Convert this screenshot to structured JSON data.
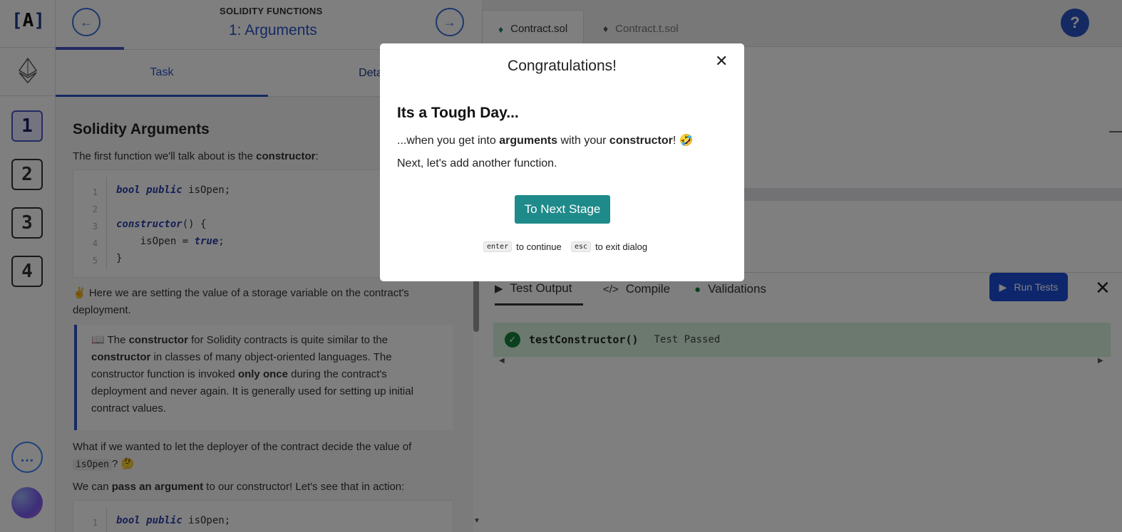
{
  "rail": {
    "logo_left": "[",
    "logo_mid": "A",
    "logo_right": "]",
    "stages": [
      "1",
      "2",
      "3",
      "4"
    ],
    "active_stage": 1,
    "more_icon": "…"
  },
  "header": {
    "course": "SOLIDITY FUNCTIONS",
    "title": "1: Arguments",
    "prev_icon": "←",
    "next_icon": "→"
  },
  "tabs": {
    "task": "Task",
    "details": "Deta"
  },
  "content": {
    "heading": "Solidity Arguments",
    "p1_pre": "The first function we'll talk about is the ",
    "p1_bold": "constructor",
    "p1_post": ":",
    "code1": [
      {
        "n": "1",
        "line": "bool public isOpen;"
      },
      {
        "n": "2",
        "line": ""
      },
      {
        "n": "3",
        "line": "constructor() {"
      },
      {
        "n": "4",
        "line": "    isOpen = true;"
      },
      {
        "n": "5",
        "line": "}"
      }
    ],
    "p2": "✌️ Here we are setting the value of a storage variable on the contract's deployment.",
    "note_pre": "📖 The ",
    "note_b1": "constructor",
    "note_mid1": " for Solidity contracts is quite similar to the ",
    "note_b2": "constructor",
    "note_mid2": " in classes of many object-oriented languages. The constructor function is invoked ",
    "note_b3": "only once",
    "note_post": " during the contract's deployment and never again. It is generally used for setting up initial contract values.",
    "p3_pre": "What if we wanted to let the deployer of the contract decide the value of ",
    "p3_code": "isOpen",
    "p3_post": "? 🤔",
    "p4_pre": "We can ",
    "p4_bold": "pass an argument",
    "p4_post": " to our constructor! Let's see that in action:",
    "code2": [
      {
        "n": "1",
        "line": "bool public isOpen;"
      }
    ]
  },
  "editor": {
    "tabs": [
      "Contract.sol",
      "Contract.t.sol"
    ],
    "help_icon": "?"
  },
  "bottom": {
    "tabs": [
      "Test Output",
      "Compile",
      "Validations"
    ],
    "run_label": "Run Tests",
    "close_icon": "✕",
    "test_name": "testConstructor()",
    "test_status": "Test Passed"
  },
  "modal": {
    "title": "Congratulations!",
    "close_icon": "✕",
    "heading": "Its a Tough Day...",
    "line1_pre": "...when you get into ",
    "line1_b1": "arguments",
    "line1_mid": " with your ",
    "line1_b2": "constructor",
    "line1_post": "! 🤣",
    "line2": "Next, let's add another function.",
    "button": "To Next Stage",
    "hint_enter_key": "enter",
    "hint_enter_text": "to continue",
    "hint_esc_key": "esc",
    "hint_esc_text": "to exit dialog"
  },
  "colors": {
    "accent": "#2b55c7",
    "primary_button": "#1f8a8a",
    "run_button": "#1d4ed8",
    "pass_bg": "#d7f3df",
    "overlay": "rgba(0,0,0,0.5)"
  }
}
